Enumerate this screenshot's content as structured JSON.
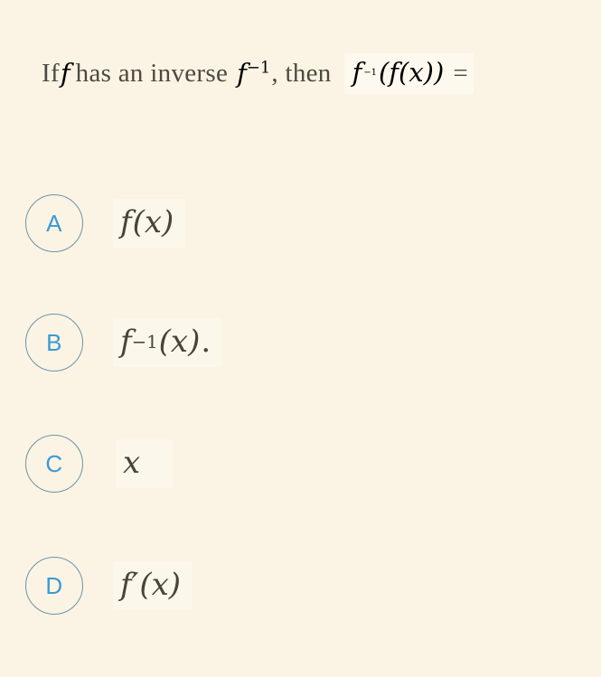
{
  "background_color": "#fbf4e4",
  "accent_color": "#3c9ad6",
  "bubble_stroke_color": "#6d94a8",
  "text_color": "#4c4a40",
  "question": {
    "prefix": "If",
    "variable": "f",
    "middle": "has an inverse",
    "inverse_symbol": "f",
    "inverse_exponent": "−1",
    "comma_then": ", then",
    "expression": "f⁻¹(f(x)) =",
    "expr_base": "f",
    "expr_exponent": "−1",
    "expr_args": "(f(x))",
    "equals": "="
  },
  "options": [
    {
      "letter": "A",
      "answer_text": "f(x)",
      "base": "f",
      "exponent": "",
      "args": "(x)",
      "suffix": ""
    },
    {
      "letter": "B",
      "answer_text": "f⁻¹(x).",
      "base": "f",
      "exponent": "−1",
      "args": "(x)",
      "suffix": "."
    },
    {
      "letter": "C",
      "answer_text": "x",
      "base": "x",
      "exponent": "",
      "args": "",
      "suffix": ""
    },
    {
      "letter": "D",
      "answer_text": "f′(x)",
      "base": "f",
      "exponent": "",
      "prime": "′",
      "args": "(x)",
      "suffix": ""
    }
  ]
}
